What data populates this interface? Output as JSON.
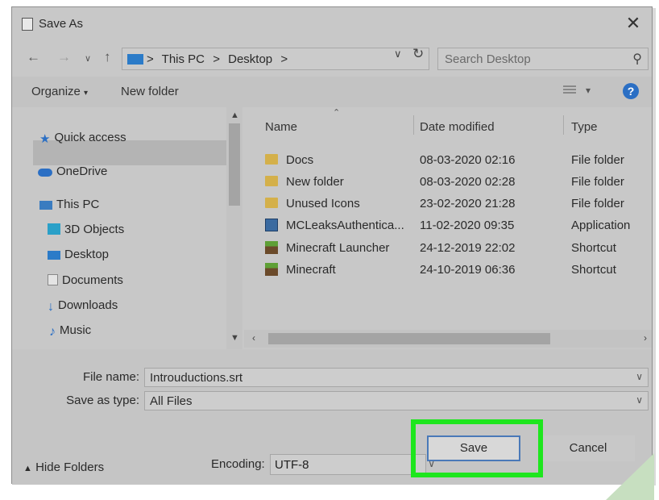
{
  "window": {
    "title": "Save As",
    "close_glyph": "✕"
  },
  "address": {
    "crumbs": [
      "This PC",
      "Desktop"
    ],
    "separator": ">"
  },
  "search": {
    "placeholder": "Search Desktop"
  },
  "toolbar": {
    "organize": "Organize",
    "new_folder": "New folder",
    "help": "?"
  },
  "nav_pane": {
    "items": [
      {
        "label": "Quick access",
        "icon": "star-icon"
      },
      {
        "label": "OneDrive",
        "icon": "cloud-icon"
      },
      {
        "label": "This PC",
        "icon": "computer-icon"
      },
      {
        "label": "3D Objects",
        "icon": "cube-icon"
      },
      {
        "label": "Desktop",
        "icon": "desktop-icon",
        "selected": true
      },
      {
        "label": "Documents",
        "icon": "document-icon"
      },
      {
        "label": "Downloads",
        "icon": "download-icon"
      },
      {
        "label": "Music",
        "icon": "music-icon"
      }
    ]
  },
  "file_list": {
    "columns": [
      "Name",
      "Date modified",
      "Type"
    ],
    "rows": [
      {
        "name": "Docs",
        "date": "08-03-2020 02:16",
        "type": "File folder",
        "icon": "folder-icon"
      },
      {
        "name": "New folder",
        "date": "08-03-2020 02:28",
        "type": "File folder",
        "icon": "folder-icon"
      },
      {
        "name": "Unused Icons",
        "date": "23-02-2020 21:28",
        "type": "File folder",
        "icon": "folder-icon"
      },
      {
        "name": "MCLeaksAuthentica...",
        "date": "11-02-2020 09:35",
        "type": "Application",
        "icon": "app-icon"
      },
      {
        "name": "Minecraft Launcher",
        "date": "24-12-2019 22:02",
        "type": "Shortcut",
        "icon": "minecraft-icon"
      },
      {
        "name": "Minecraft",
        "date": "24-10-2019 06:36",
        "type": "Shortcut",
        "icon": "minecraft-icon"
      }
    ]
  },
  "form": {
    "file_name_label": "File name:",
    "file_name_value": "Introuductions.srt",
    "save_type_label": "Save as type:",
    "save_type_value": "All Files",
    "encoding_label": "Encoding:",
    "encoding_value": "UTF-8"
  },
  "footer": {
    "hide_folders": "Hide Folders",
    "save": "Save",
    "cancel": "Cancel"
  },
  "colors": {
    "highlight": "#1ee61e",
    "accent": "#2b6fc4"
  }
}
